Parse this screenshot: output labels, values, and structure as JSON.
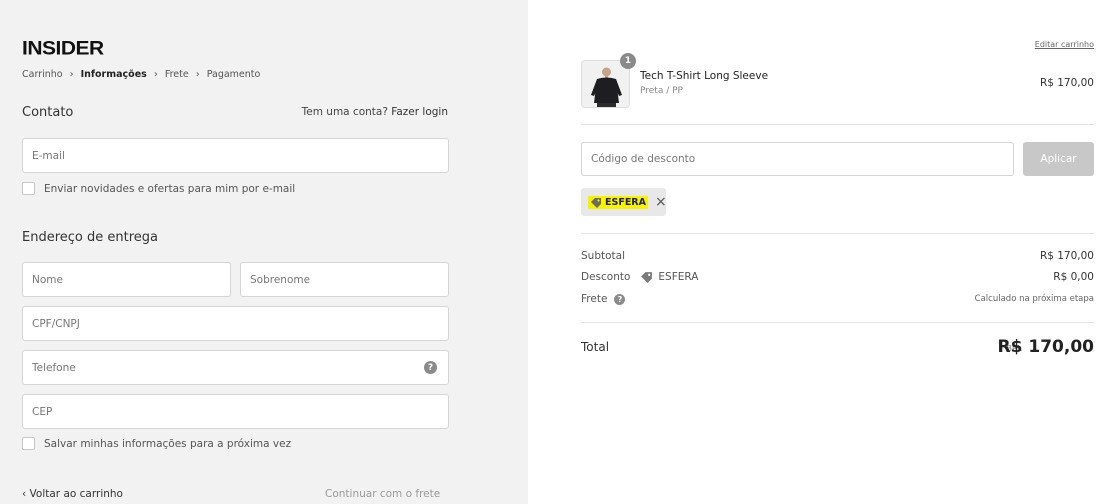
{
  "brand": {
    "logo": "INSIDER"
  },
  "breadcrumb": [
    {
      "label": "Carrinho"
    },
    {
      "label": "Informações"
    },
    {
      "label": "Frete"
    },
    {
      "label": "Pagamento"
    }
  ],
  "contact": {
    "title": "Contato",
    "login_prompt": "Tem uma conta?",
    "login_link": "Fazer login",
    "email_placeholder": "E-mail",
    "newsletter_label": "Enviar novidades e ofertas para mim por e-mail"
  },
  "shipping": {
    "title": "Endereço de entrega",
    "first_name": "Nome",
    "last_name": "Sobrenome",
    "cpf": "CPF/CNPJ",
    "phone": "Telefone",
    "cep": "CEP",
    "save_label": "Salvar minhas informações para a próxima vez"
  },
  "footer": {
    "back": "Voltar ao carrinho",
    "continue": "Continuar com o frete"
  },
  "cart": {
    "edit_link": "Editar carrinho",
    "item": {
      "quantity": "1",
      "name": "Tech T-Shirt Long Sleeve",
      "variant": "Preta / PP",
      "price": "R$ 170,00"
    },
    "discount_placeholder": "Código de desconto",
    "apply_label": "Aplicar",
    "applied_code": "ESFERA"
  },
  "summary": {
    "subtotal_label": "Subtotal",
    "subtotal_value": "R$ 170,00",
    "discount_label": "Desconto",
    "discount_code": "ESFERA",
    "discount_value": "R$ 0,00",
    "shipping_label": "Frete",
    "shipping_value": "Calculado na próxima etapa",
    "total_label": "Total",
    "currency": "BRL",
    "total_value": "R$ 170,00"
  },
  "colors": {
    "left_bg": "#f2f2f2",
    "highlight": "#f6f200",
    "button_disabled": "#c8c8c8"
  }
}
